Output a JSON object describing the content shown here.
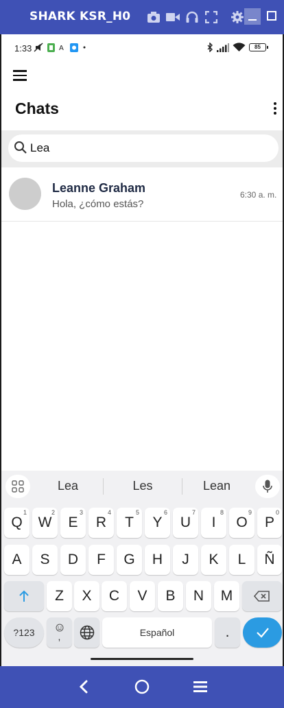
{
  "emulator": {
    "title": "SHARK KSR_H0"
  },
  "status_bar": {
    "time": "1:33",
    "battery": "85"
  },
  "header": {
    "title": "Chats"
  },
  "search": {
    "value": "Lea",
    "placeholder": ""
  },
  "chats": [
    {
      "name": "Leanne Graham",
      "last_message": "Hola, ¿cómo estás?",
      "time": "6:30 a. m."
    }
  ],
  "keyboard": {
    "suggestions": [
      "Lea",
      "Les",
      "Lean"
    ],
    "row1": [
      "Q",
      "W",
      "E",
      "R",
      "T",
      "Y",
      "U",
      "I",
      "O",
      "P"
    ],
    "row1_hints": [
      "1",
      "2",
      "3",
      "4",
      "5",
      "6",
      "7",
      "8",
      "9",
      "0"
    ],
    "row2": [
      "A",
      "S",
      "D",
      "F",
      "G",
      "H",
      "J",
      "K",
      "L",
      "Ñ"
    ],
    "row3": [
      "Z",
      "X",
      "C",
      "V",
      "B",
      "N",
      "M"
    ],
    "symbols_label": "?123",
    "emoji_comma": ",",
    "space_label": "Español",
    "period": "."
  },
  "colors": {
    "chrome": "#3f51b5",
    "enter_key": "#2b9be2",
    "avatar": "#cdcdcd"
  }
}
